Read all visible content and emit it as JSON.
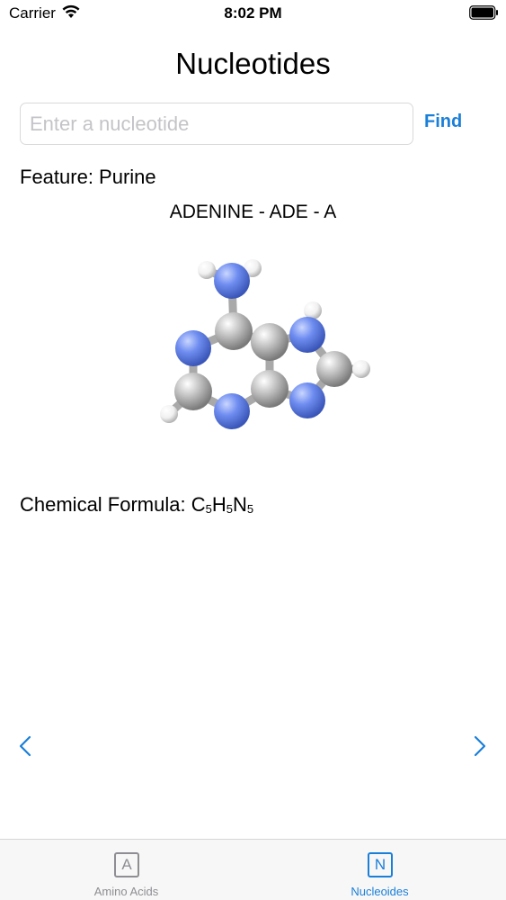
{
  "status_bar": {
    "carrier": "Carrier",
    "time": "8:02 PM"
  },
  "header": {
    "title": "Nucleotides"
  },
  "search": {
    "placeholder": "Enter a nucleotide",
    "value": "",
    "find_label": "Find"
  },
  "detail": {
    "feature": "Feature: Purine",
    "name_line": "ADENINE - ADE - A",
    "formula_prefix": "Chemical Formula: ",
    "formula": [
      {
        "symbol": "C",
        "count": "5"
      },
      {
        "symbol": "H",
        "count": "5"
      },
      {
        "symbol": "N",
        "count": "5"
      }
    ]
  },
  "tabs": [
    {
      "icon_letter": "A",
      "label": "Amino Acids",
      "selected": false
    },
    {
      "icon_letter": "N",
      "label": "Nucleoides",
      "selected": true
    }
  ],
  "colors": {
    "accent": "#1a7fd9",
    "nitrogen": "#5b7fe8",
    "carbon": "#b8b8b8",
    "hydrogen": "#f2f2f2",
    "inactive": "#8e8e93"
  }
}
